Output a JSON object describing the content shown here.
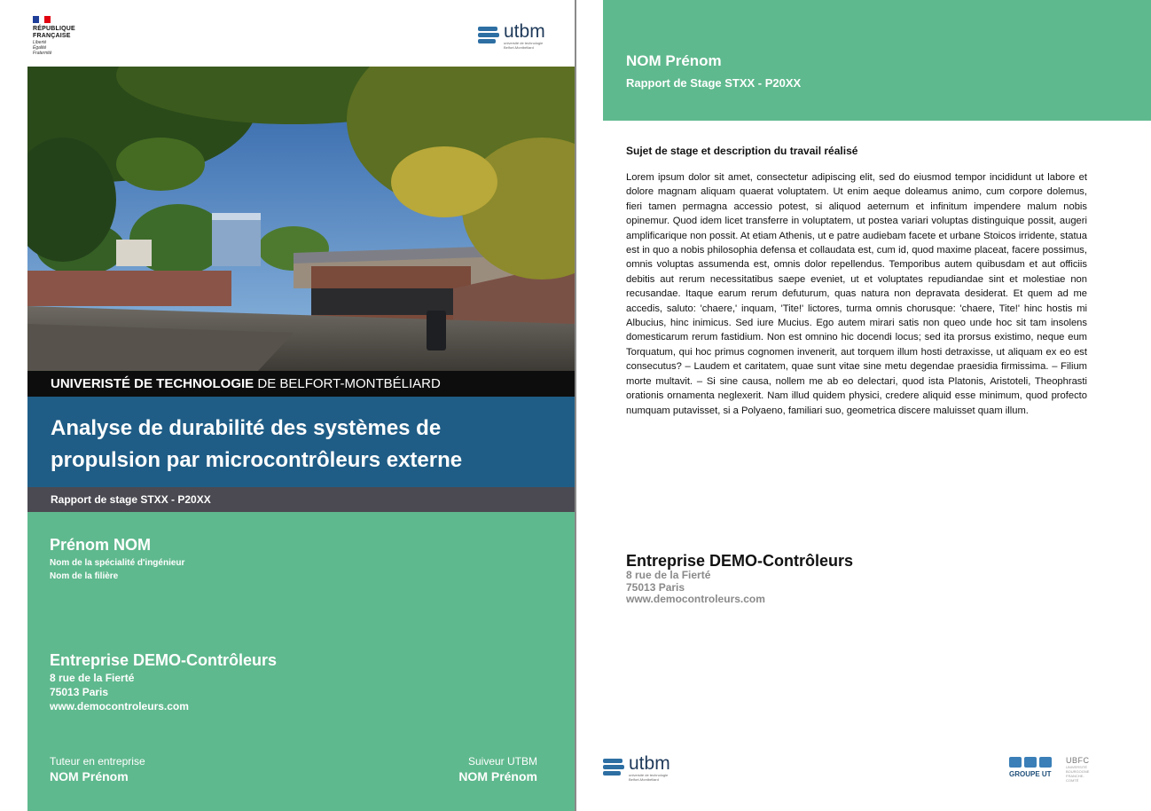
{
  "left_page": {
    "republique": {
      "line1": "RÉPUBLIQUE",
      "line2": "FRANÇAISE",
      "motto1": "Liberté",
      "motto2": "Égalité",
      "motto3": "Fraternité"
    },
    "utbm_logo": {
      "word": "utbm",
      "sub1": "université de technologie",
      "sub2": "Belfort-Montbéliard"
    },
    "university_bold": "UNIVERISTÉ DE TECHNOLOGIE",
    "university_rest": " DE BELFORT-MONTBÉLIARD",
    "title_line1": "Analyse de durabilité des systèmes de",
    "title_line2": "propulsion par microcontrôleurs externe",
    "report_label": "Rapport de stage STXX - P20XX",
    "student_name": "Prénom NOM",
    "speciality": "Nom de la spécialité d'ingénieur",
    "filiere": "Nom de la filière",
    "company_name": "Entreprise DEMO-Contrôleurs",
    "company_address1": "8 rue de la Fierté",
    "company_address2": "75013 Paris",
    "company_website": "www.democontroleurs.com",
    "tutor_label": "Tuteur en entreprise",
    "tutor_name": "NOM Prénom",
    "suiveur_label": "Suiveur UTBM",
    "suiveur_name": "NOM Prénom"
  },
  "right_page": {
    "name": "NOM Prénom",
    "report": "Rapport de Stage STXX - P20XX",
    "subject_heading": "Sujet de stage et description du travail réalisé",
    "body_text": "Lorem ipsum dolor sit amet, consectetur adipiscing elit, sed do eiusmod tempor incididunt ut labore et dolore magnam aliquam quaerat voluptatem. Ut enim aeque doleamus animo, cum corpore dolemus, fieri tamen permagna accessio potest, si aliquod aeternum et infinitum impendere malum nobis opinemur. Quod idem licet transferre in voluptatem, ut postea variari voluptas distinguique possit, augeri amplificarique non possit. At etiam Athenis, ut e patre audiebam facete et urbane Stoicos irridente, statua est in quo a nobis philosophia defensa et collaudata est, cum id, quod maxime placeat, facere possimus, omnis voluptas assumenda est, omnis dolor repellendus. Temporibus autem quibusdam et aut officiis debitis aut rerum necessitatibus saepe eveniet, ut et voluptates repudiandae sint et molestiae non recusandae. Itaque earum rerum defuturum, quas natura non depravata desiderat. Et quem ad me accedis, saluto: 'chaere,' inquam, 'Tite!' lictores, turma omnis chorusque: 'chaere, Tite!' hinc hostis mi Albucius, hinc inimicus. Sed iure Mucius. Ego autem mirari satis non queo unde hoc sit tam insolens domesticarum rerum fastidium. Non est omnino hic docendi locus; sed ita prorsus existimo, neque eum Torquatum, qui hoc primus cognomen invenerit, aut torquem illum hosti detraxisse, ut aliquam ex eo est consecutus? – Laudem et caritatem, quae sunt vitae sine metu degendae praesidia firmissima. – Filium morte multavit. – Si sine causa, nollem me ab eo delectari, quod ista Platonis, Aristoteli, Theophrasti orationis ornamenta neglexerit. Nam illud quidem physici, credere aliquid esse minimum, quod profecto numquam putavisset, si a Polyaeno, familiari suo, geometrica discere maluisset quam illum.",
    "company_name": "Entreprise DEMO-Contrôleurs",
    "company_address1": "8 rue de la Fierté",
    "company_address2": "75013 Paris",
    "company_website": "www.democontroleurs.com",
    "utbm_logo": {
      "word": "utbm",
      "sub1": "université de technologie",
      "sub2": "Belfort-Montbéliard"
    },
    "groupe_ut_label": "GROUPE UT",
    "ubfc_label": "UBFC",
    "ubfc_sub": "UNIVERSITÉ BOURGOGNE FRANCHE-COMTÉ"
  },
  "colors": {
    "green": "#5fb98e",
    "blue": "#1f5d86",
    "dark_band": "#4b4a52",
    "black_band": "#0d0d0d"
  }
}
